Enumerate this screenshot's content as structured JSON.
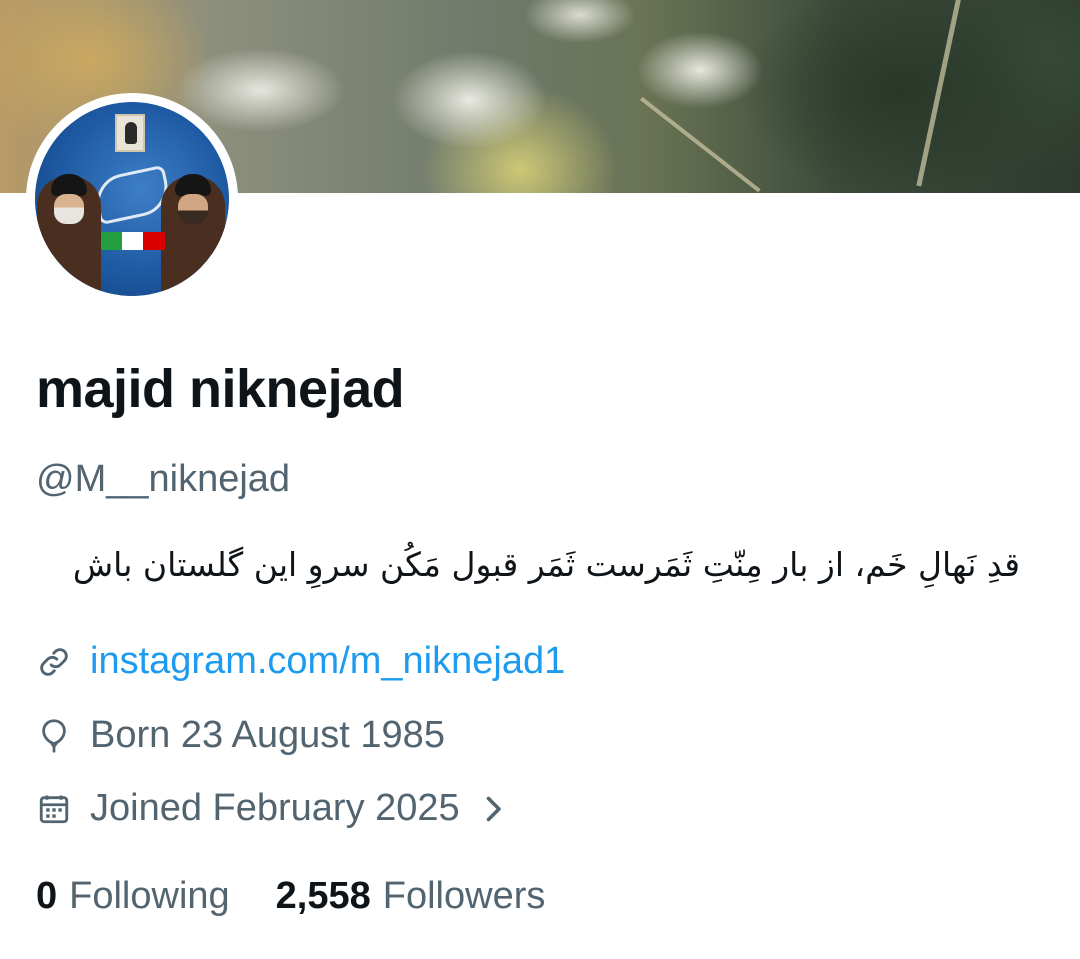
{
  "profile": {
    "name": "majid niknejad",
    "handle": "@M__niknejad",
    "bio": "قدِ نَهالِ خَم، از بار مِنّتِ ثَمَرست ثَمَر قبول مَکُن سروِ این گلستان باش",
    "website": "instagram.com/m_niknejad1",
    "birth": "Born 23 August 1985",
    "joined": "Joined February 2025"
  },
  "stats": {
    "following_count": "0",
    "following_label": "Following",
    "followers_count": "2,558",
    "followers_label": "Followers"
  },
  "icons": {
    "website": "link-icon",
    "birth": "balloon-icon",
    "joined": "calendar-icon",
    "joined_more": "chevron-right-icon"
  },
  "colors": {
    "text_primary": "#0f1419",
    "text_secondary": "#536471",
    "link": "#1d9bf0"
  }
}
